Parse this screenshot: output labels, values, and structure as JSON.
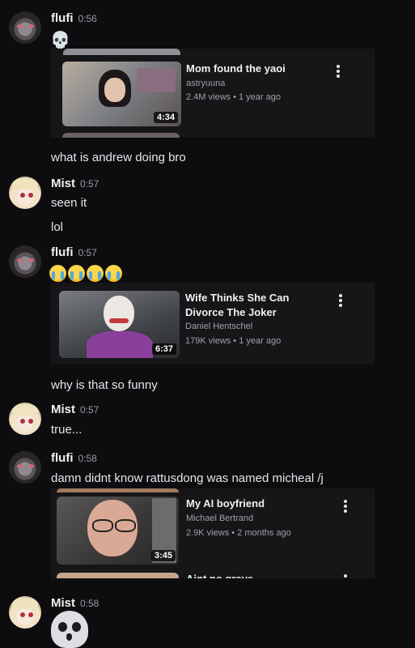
{
  "messages": [
    {
      "user": "flufi",
      "time": "0:56"
    },
    {
      "user": "Mist",
      "time": "0:57"
    },
    {
      "user": "flufi",
      "time": "0:57"
    },
    {
      "user": "Mist",
      "time": "0:57"
    },
    {
      "user": "flufi",
      "time": "0:58"
    },
    {
      "user": "Mist",
      "time": "0:58"
    }
  ],
  "texts": {
    "andrew": "what is andrew doing bro",
    "seen": "seen it",
    "lol": "lol",
    "funny": "why is that so funny",
    "true": "true...",
    "damn": "damn didnt know rattusdong was named micheal /j"
  },
  "emoji": {
    "skull_small": "💀",
    "sob_count": 4
  },
  "videos": [
    {
      "title": "Mom found the yaoi",
      "channel": "astryuuna",
      "meta": "2.4M views • 1 year ago",
      "duration": "4:34"
    },
    {
      "title": "Wife Thinks She Can Divorce The Joker",
      "channel": "Daniel Hentschel",
      "meta": "179K views • 1 year ago",
      "duration": "6:37"
    },
    {
      "title": "My AI boyfriend",
      "channel": "Michael Bertrand",
      "meta": "2.9K views • 2 months ago",
      "duration": "3:45"
    },
    {
      "title": "Aint no grave",
      "channel": "",
      "meta": "",
      "duration": ""
    }
  ],
  "colors": {
    "background": "#0d0d10",
    "embed": "#161619",
    "muted": "#9a9aa0"
  }
}
